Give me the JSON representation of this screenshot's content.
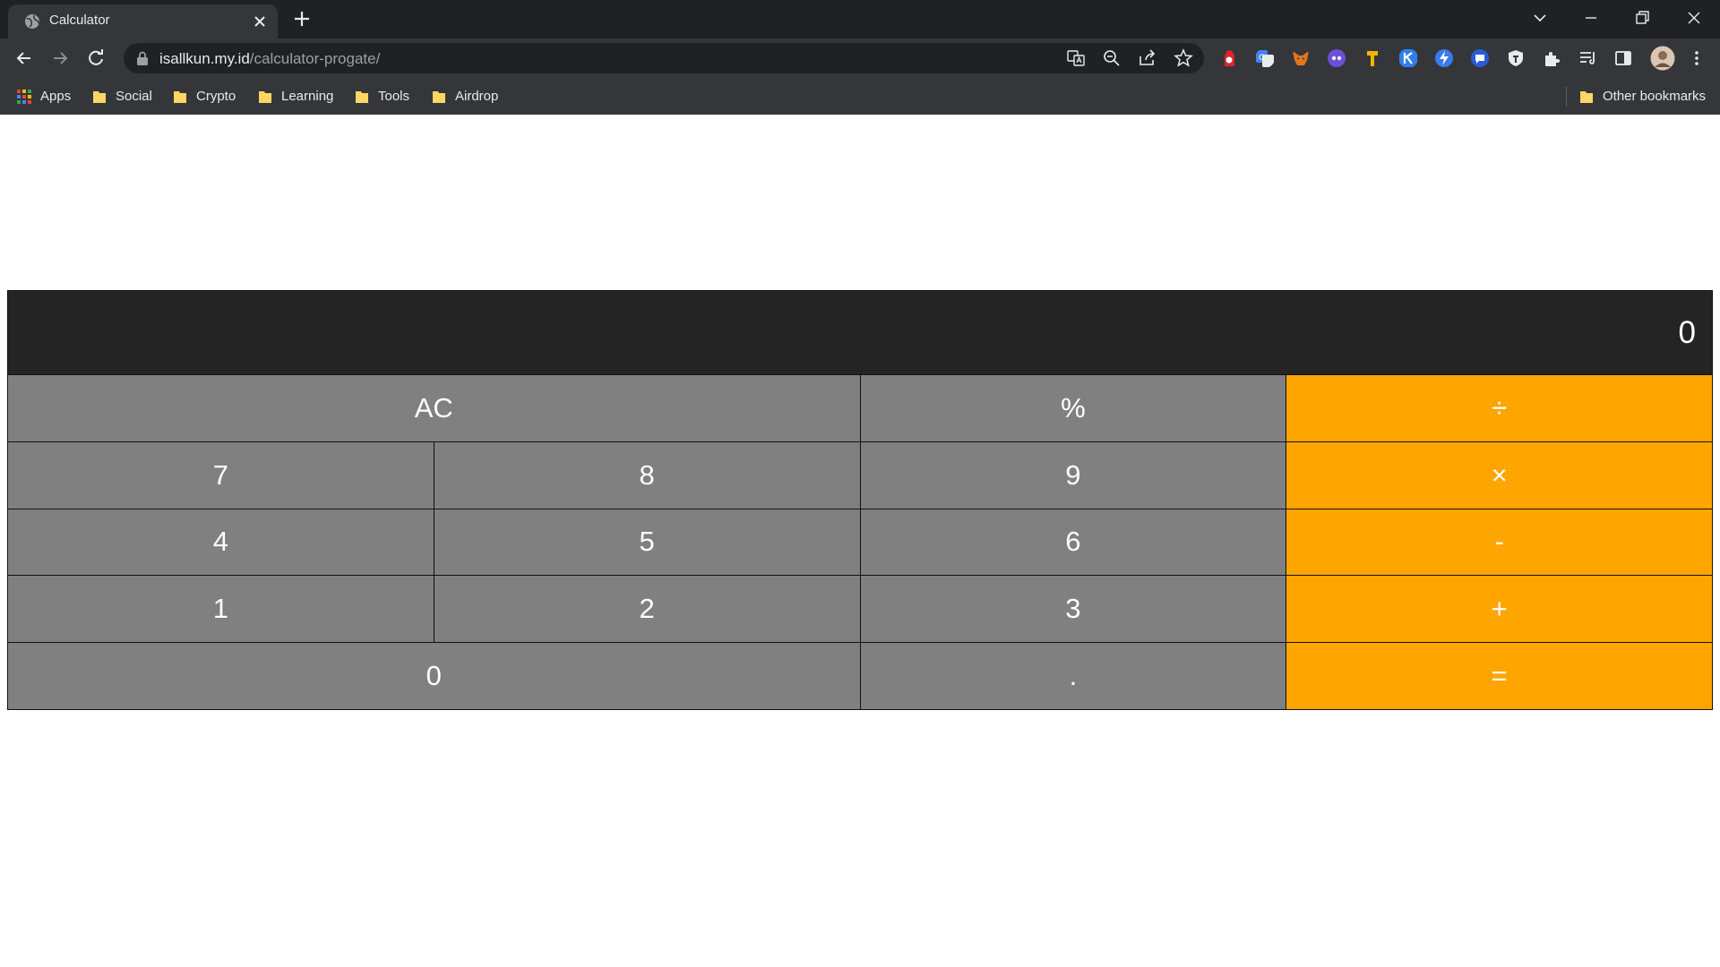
{
  "browser": {
    "tab_title": "Calculator",
    "url_domain": "isallkun.my.id",
    "url_path": "/calculator-progate/",
    "bookmarks": [
      "Apps",
      "Social",
      "Crypto",
      "Learning",
      "Tools",
      "Airdrop"
    ],
    "other_bookmarks": "Other bookmarks",
    "colors": {
      "frame": "#202124",
      "toolbar": "#35363a",
      "text": "#e8eaed"
    }
  },
  "calculator": {
    "display_value": "0",
    "keys": {
      "ac": "AC",
      "percent": "%",
      "divide": "÷",
      "seven": "7",
      "eight": "8",
      "nine": "9",
      "multiply": "×",
      "four": "4",
      "five": "5",
      "six": "6",
      "minus": "-",
      "one": "1",
      "two": "2",
      "three": "3",
      "plus": "+",
      "zero": "0",
      "decimal": ".",
      "equals": "="
    },
    "colors": {
      "display_bg": "#242424",
      "key_bg": "#808080",
      "operator_bg": "#ffa500",
      "text": "#ffffff"
    }
  }
}
